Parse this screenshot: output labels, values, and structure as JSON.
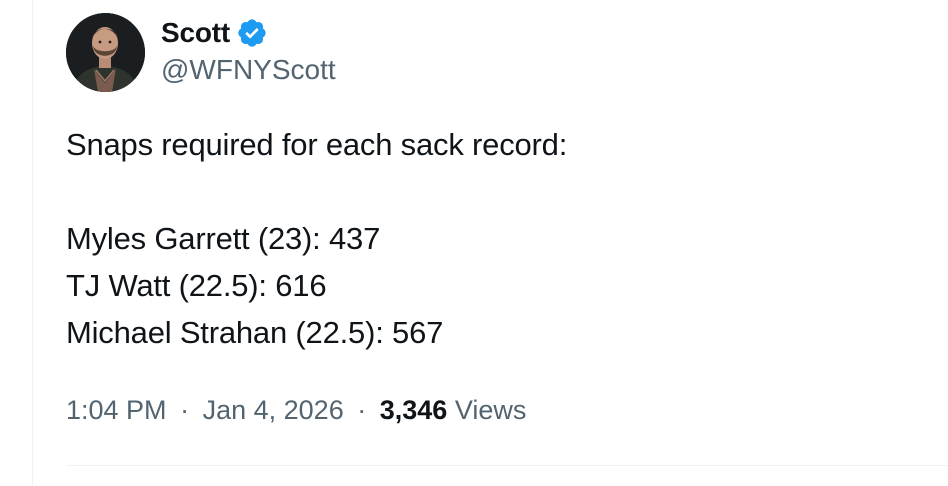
{
  "author": {
    "display_name": "Scott",
    "handle": "@WFNYScott",
    "verified": true,
    "verified_color": "#1d9bf0"
  },
  "tweet": {
    "text_lines": [
      "Snaps required for each sack record:",
      "",
      "Myles Garrett (23): 437",
      "TJ Watt (22.5): 616",
      "Michael Strahan (22.5): 567"
    ],
    "time": "1:04 PM",
    "date": "Jan 4, 2026",
    "separator": "·",
    "views_count": "3,346",
    "views_label": "Views"
  },
  "colors": {
    "text_primary": "#0f1419",
    "text_secondary": "#536471",
    "border": "#eff3f4"
  },
  "icons": {
    "verified": "verified-badge-icon",
    "avatar": "profile-photo"
  }
}
